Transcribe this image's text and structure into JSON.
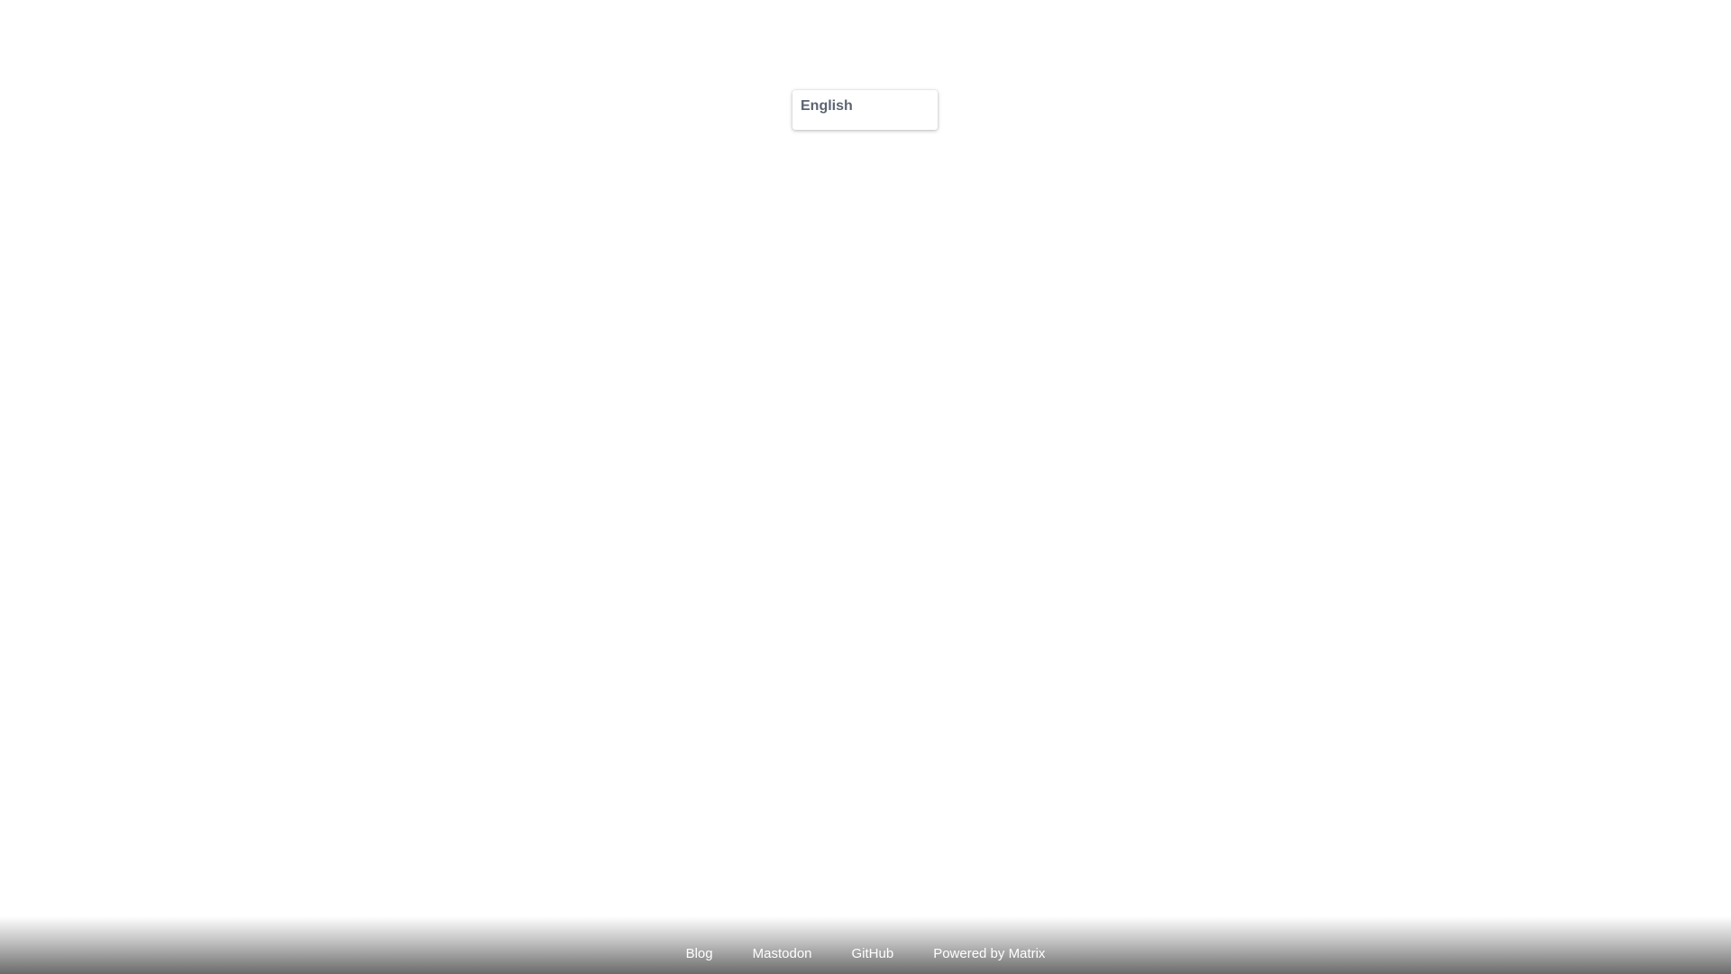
{
  "language_selector": {
    "selected": "English"
  },
  "footer": {
    "links": [
      {
        "label": "Blog"
      },
      {
        "label": "Mastodon"
      },
      {
        "label": "GitHub"
      },
      {
        "label": "Powered by Matrix"
      }
    ]
  },
  "colors": {
    "background": "#ffffff",
    "language_text": "#5c6470",
    "footer_link_text": "#ffffff"
  }
}
